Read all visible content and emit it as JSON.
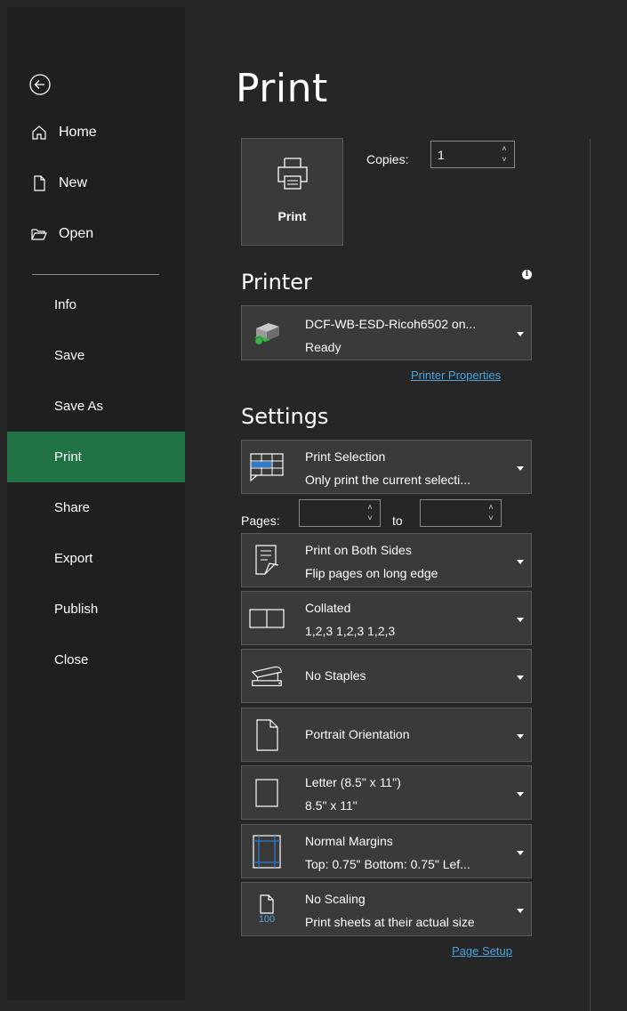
{
  "sidebar": {
    "top_items": [
      {
        "label": "Home",
        "icon": "home-icon"
      },
      {
        "label": "New",
        "icon": "new-document-icon"
      },
      {
        "label": "Open",
        "icon": "open-folder-icon"
      }
    ],
    "items": [
      {
        "label": "Info"
      },
      {
        "label": "Save"
      },
      {
        "label": "Save As"
      },
      {
        "label": "Print",
        "active": true
      },
      {
        "label": "Share"
      },
      {
        "label": "Export"
      },
      {
        "label": "Publish"
      },
      {
        "label": "Close"
      }
    ]
  },
  "main": {
    "title": "Print",
    "print_button_label": "Print",
    "copies_label": "Copies:",
    "copies_value": "1",
    "printer_heading": "Printer",
    "printer": {
      "name": "DCF-WB-ESD-Ricoh6502 on...",
      "status": "Ready"
    },
    "printer_properties_link": "Printer Properties",
    "settings_heading": "Settings",
    "settings": [
      {
        "line1": "Print Selection",
        "line2": "Only print the current selecti...",
        "icon": "print-selection-icon"
      },
      {
        "line1": "Print on Both Sides",
        "line2": "Flip pages on long edge",
        "icon": "duplex-icon"
      },
      {
        "line1": "Collated",
        "line2": "1,2,3   1,2,3   1,2,3",
        "icon": "collated-icon"
      },
      {
        "line1": "No Staples",
        "line2": "",
        "icon": "stapler-icon"
      },
      {
        "line1": "Portrait Orientation",
        "line2": "",
        "icon": "portrait-page-icon"
      },
      {
        "line1": "Letter (8.5\" x 11\")",
        "line2": "8.5\" x 11\"",
        "icon": "paper-size-icon"
      },
      {
        "line1": "Normal Margins",
        "line2": "Top: 0.75\" Bottom: 0.75\" Lef...",
        "icon": "margins-icon"
      },
      {
        "line1": "No Scaling",
        "line2": "Print sheets at their actual size",
        "icon": "no-scaling-icon"
      }
    ],
    "pages_label": "Pages:",
    "to_label": "to",
    "pages_from": "",
    "pages_to": "",
    "scaling_icon_text": "100",
    "page_setup_link": "Page Setup"
  },
  "colors": {
    "accent": "#217346",
    "link": "#4aa3df",
    "scaling_icon": "#4aa3df"
  }
}
